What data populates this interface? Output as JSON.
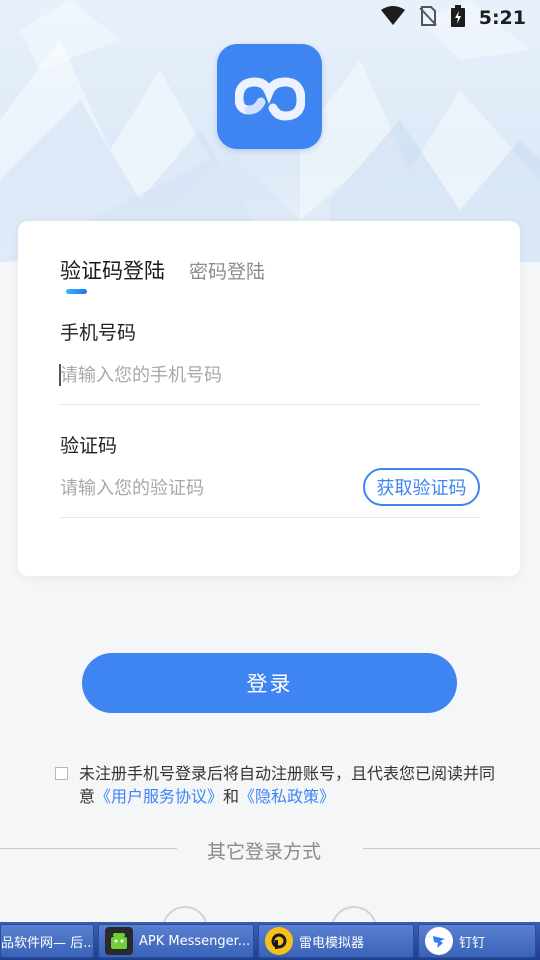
{
  "status_bar": {
    "time": "5:21"
  },
  "login_card": {
    "tabs": [
      {
        "label": "验证码登陆",
        "active": true
      },
      {
        "label": "密码登陆",
        "active": false
      }
    ],
    "phone": {
      "label": "手机号码",
      "placeholder": "请输入您的手机号码",
      "value": ""
    },
    "code": {
      "label": "验证码",
      "placeholder": "请输入您的验证码",
      "value": "",
      "button_label": "获取验证码"
    }
  },
  "login_button": {
    "label": "登录"
  },
  "agreement": {
    "checked": false,
    "text_before": "未注册手机号登录后将自动注册账号，且代表您已阅读并同意",
    "terms_link": "《用户服务协议》",
    "conjunction": "和",
    "privacy_link": "《隐私政策》"
  },
  "other_login": {
    "label": "其它登录方式"
  },
  "taskbar": {
    "items": [
      {
        "label": "品软件网— 后...",
        "icon": "window-icon"
      },
      {
        "label": "APK Messenger...",
        "icon": "android-icon"
      },
      {
        "label": "雷电模拟器",
        "icon": "ldplayer-icon"
      },
      {
        "label": "钉钉",
        "icon": "dingtalk-icon"
      }
    ]
  },
  "colors": {
    "accent": "#3e85f2",
    "background": "#f5f6f8",
    "card": "#ffffff"
  }
}
